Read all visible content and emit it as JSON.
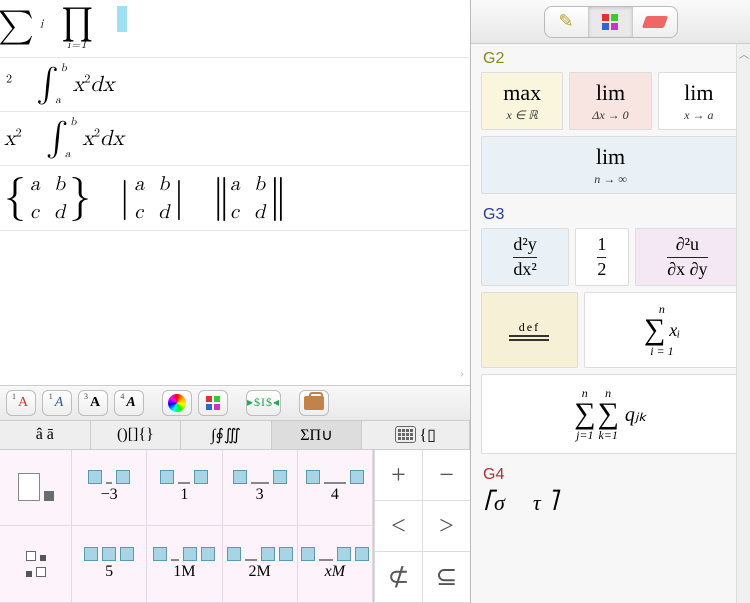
{
  "doc": {
    "row1": {
      "expr_left_sup": "i",
      "prod_sub": "i=1"
    },
    "row2": {
      "left_sup": "2",
      "int_a": "a",
      "int_b": "b",
      "integrand": "x",
      "int_exp": "2",
      "dx": "dx"
    },
    "row3": {
      "left": "x",
      "left_sup": "2",
      "int_a": "a",
      "int_b": "b",
      "integrand": "x",
      "int_exp": "2",
      "dx": "dx"
    },
    "row4": {
      "m11": "a",
      "m12": "b",
      "m21": "c",
      "m22": "d"
    }
  },
  "toolbar": {
    "a1_sup": "1",
    "a2_sup": "1",
    "a3_sup": "3",
    "a4_sup": "4",
    "a1": "A",
    "a2": "A",
    "a3": "A",
    "a4": "A",
    "dollar": "▸$I$◂"
  },
  "cat_tabs": {
    "t1": "â ā",
    "t2": "()[]{}",
    "t3": "∫∮∭",
    "t4": "ΣΠ∪",
    "t5": "{▯"
  },
  "templates": {
    "labels": [
      "−3",
      "1",
      "3",
      "4",
      "5",
      "1M",
      "2M",
      "xM"
    ]
  },
  "ops": [
    "+",
    "−",
    "<",
    ">",
    "⊄",
    "⊆"
  ],
  "right": {
    "g2": "G2",
    "g2_tiles": {
      "max": {
        "top": "max",
        "sub": "x ∈ ℝ"
      },
      "lim1": {
        "top": "lim",
        "sub": "Δx → 0"
      },
      "lim2": {
        "top": "lim",
        "sub": "x → a"
      },
      "lim3": {
        "top": "lim",
        "sub": "n → ∞"
      }
    },
    "g3": "G3",
    "g3_tiles": {
      "ddy": {
        "num": "d²y",
        "den": "dx²"
      },
      "half": {
        "num": "1",
        "den": "2"
      },
      "partial": {
        "num": "∂²u",
        "den": "∂x ∂y"
      },
      "def": "def",
      "sum1": {
        "top": "n",
        "term": "xᵢ",
        "bot": "i = 1"
      },
      "sum2": {
        "top1": "n",
        "bot1": "j=1",
        "top2": "n",
        "bot2": "k=1",
        "term": "qⱼₖ"
      }
    },
    "g4": "G4",
    "g4_frag_l": "⎡σ",
    "g4_frag_r": "τ  ⎤"
  }
}
